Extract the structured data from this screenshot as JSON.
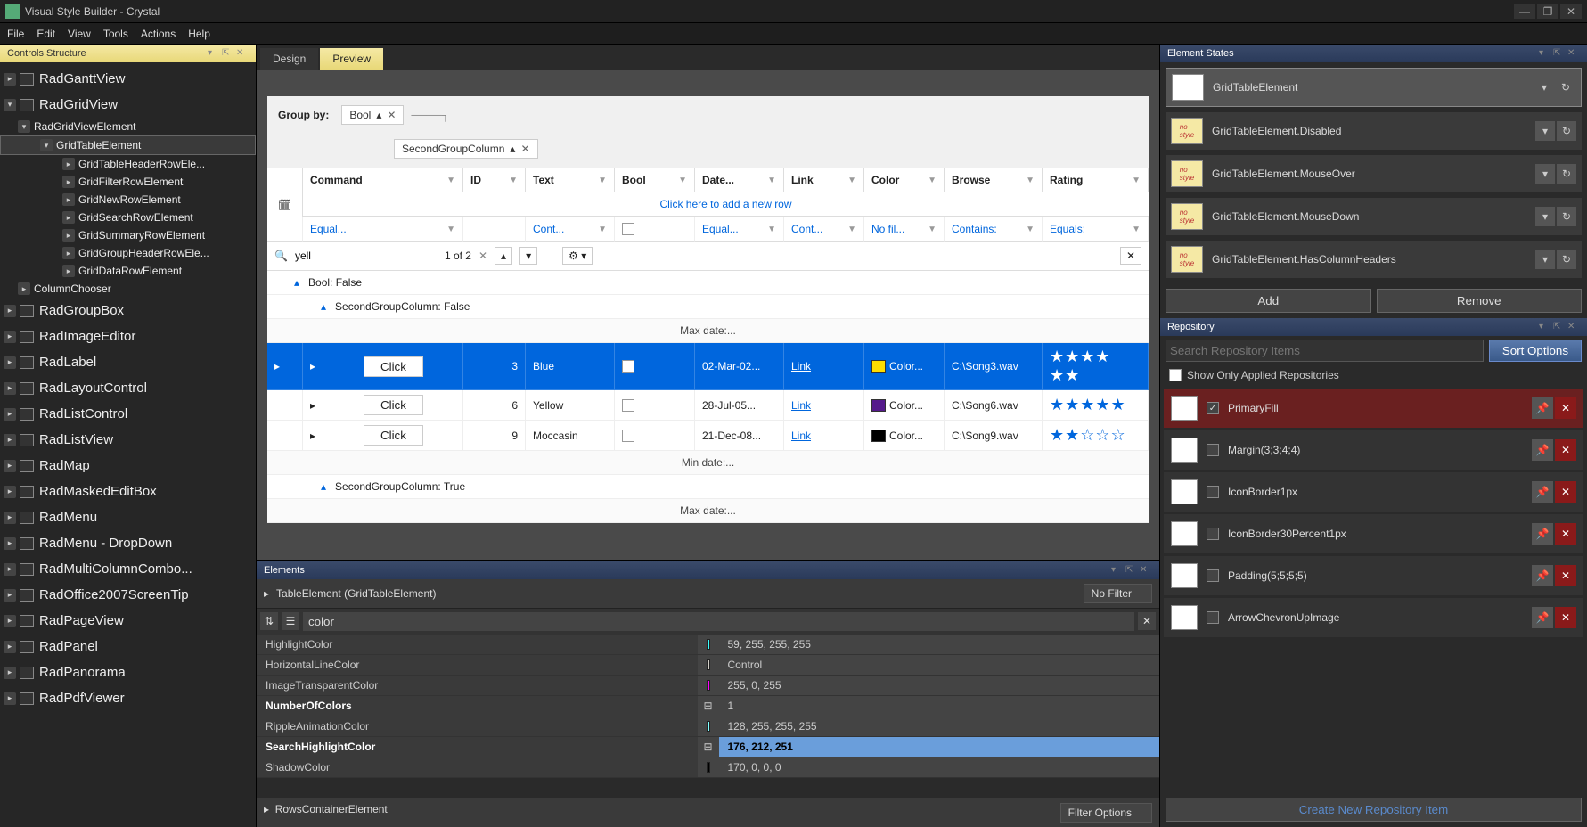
{
  "window": {
    "title": "Visual Style Builder - Crystal"
  },
  "menu": [
    "File",
    "Edit",
    "View",
    "Tools",
    "Actions",
    "Help"
  ],
  "leftPanel": {
    "title": "Controls Structure",
    "tree": {
      "top": [
        {
          "label": "RadGanttView",
          "exp": "▸"
        },
        {
          "label": "RadGridView",
          "exp": "▾"
        }
      ],
      "l1a": {
        "label": "RadGridViewElement"
      },
      "l2a": {
        "label": "GridTableElement",
        "sel": true
      },
      "l3": [
        "GridTableHeaderRowEle...",
        "GridFilterRowElement",
        "GridNewRowElement",
        "GridSearchRowElement",
        "GridSummaryRowElement",
        "GridGroupHeaderRowEle...",
        "GridDataRowElement"
      ],
      "l1b": {
        "label": "ColumnChooser"
      },
      "bottom": [
        "RadGroupBox",
        "RadImageEditor",
        "RadLabel",
        "RadLayoutControl",
        "RadListControl",
        "RadListView",
        "RadMap",
        "RadMaskedEditBox",
        "RadMenu",
        "RadMenu - DropDown",
        "RadMultiColumnCombo...",
        "RadOffice2007ScreenTip",
        "RadPageView",
        "RadPanel",
        "RadPanorama",
        "RadPdfViewer"
      ]
    }
  },
  "center": {
    "tabs": [
      {
        "label": "Design",
        "active": false
      },
      {
        "label": "Preview",
        "active": true
      }
    ],
    "grid": {
      "groupBy": "Group by:",
      "chip1": "Bool",
      "chip2": "SecondGroupColumn",
      "cols": [
        "",
        "Command",
        "ID",
        "Text",
        "Bool",
        "Date...",
        "Link",
        "Color",
        "Browse",
        "Rating"
      ],
      "newRow": "Click here to add a new row",
      "filters": [
        "",
        "Equal...",
        "",
        "Cont...",
        "",
        "Equal...",
        "Cont...",
        "No fil...",
        "Contains:",
        "Equals:"
      ],
      "search": {
        "value": "yell",
        "count": "1 of 2"
      },
      "g1": "Bool: False",
      "g2": "SecondGroupColumn: False",
      "sumMax": "Max  date:...",
      "sumMin": "Min  date:...",
      "g3": "SecondGroupColumn: True",
      "rows": [
        {
          "id": "3",
          "text": "Blue",
          "date": "02-Mar-02...",
          "link": "Link",
          "color": "#ffdd00",
          "colorTxt": "Color...",
          "browse": "C:\\Song3.wav",
          "stars": "★★★★ ★★",
          "sel": true
        },
        {
          "id": "6",
          "text": "Yellow",
          "date": "28-Jul-05...",
          "link": "Link",
          "color": "#551a8b",
          "colorTxt": "Color...",
          "browse": "C:\\Song6.wav",
          "stars": "★★★★★",
          "sel": false
        },
        {
          "id": "9",
          "text": "Moccasin",
          "date": "21-Dec-08...",
          "link": "Link",
          "color": "#000000",
          "colorTxt": "Color...",
          "browse": "C:\\Song9.wav",
          "stars": "★★☆☆☆",
          "sel": false
        }
      ],
      "click": "Click"
    }
  },
  "elements": {
    "title": "Elements",
    "dropdown": "TableElement (GridTableElement)",
    "filterLabel": "No Filter",
    "search": "color",
    "props": [
      {
        "name": "HighlightColor",
        "color": "#3bffff",
        "val": "59, 255, 255, 255"
      },
      {
        "name": "HorizontalLineColor",
        "color": "#d4d0c8",
        "val": "Control"
      },
      {
        "name": "ImageTransparentColor",
        "color": "#ff00ff",
        "val": "255, 0, 255"
      },
      {
        "name": "NumberOfColors",
        "bold": true,
        "icon": "⊞",
        "val": "1"
      },
      {
        "name": "RippleAnimationColor",
        "color": "#80ffffff",
        "val": "128, 255, 255, 255"
      },
      {
        "name": "SearchHighlightColor",
        "bold": true,
        "icon": "⊞",
        "color": "#b0d4fb",
        "val": "176, 212, 251",
        "hl": true
      },
      {
        "name": "ShadowColor",
        "color": "#000000",
        "val": "170, 0, 0, 0"
      }
    ],
    "footer": "RowsContainerElement",
    "footerRight": "Filter Options"
  },
  "right": {
    "statesTitle": "Element States",
    "states": [
      {
        "label": "GridTableElement",
        "sel": true,
        "thumb": "styled"
      },
      {
        "label": "GridTableElement.Disabled"
      },
      {
        "label": "GridTableElement.MouseOver"
      },
      {
        "label": "GridTableElement.MouseDown"
      },
      {
        "label": "GridTableElement.HasColumnHeaders"
      }
    ],
    "addBtn": "Add",
    "removeBtn": "Remove",
    "repoTitle": "Repository",
    "repoSearch": "Search Repository Items",
    "sortBtn": "Sort Options",
    "showOnly": "Show Only Applied Repositories",
    "repos": [
      {
        "label": "PrimaryFill",
        "checked": true,
        "sel": true
      },
      {
        "label": "Margin(3;3;4;4)"
      },
      {
        "label": "IconBorder1px"
      },
      {
        "label": "IconBorder30Percent1px"
      },
      {
        "label": "Padding(5;5;5;5)"
      },
      {
        "label": "ArrowChevronUpImage"
      }
    ],
    "createBtn": "Create New Repository Item"
  }
}
